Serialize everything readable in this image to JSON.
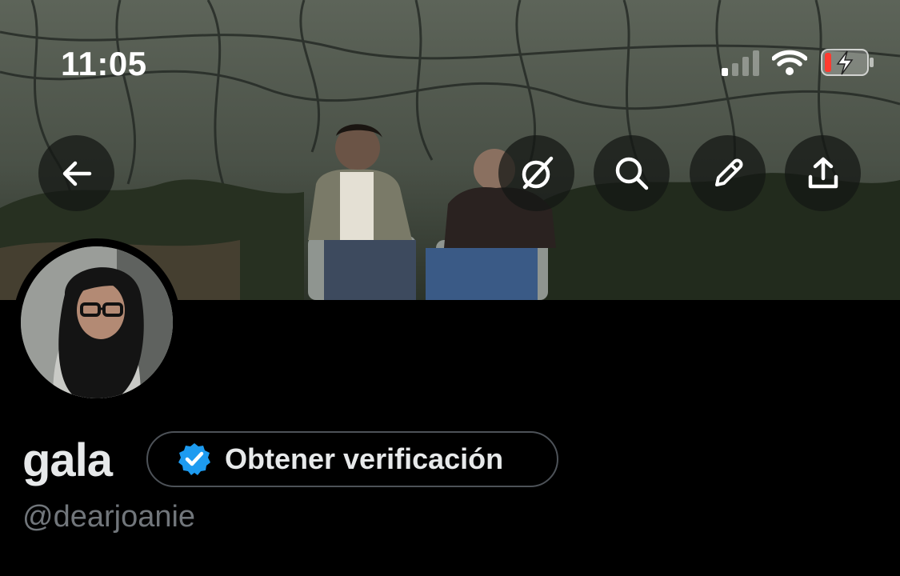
{
  "status_bar": {
    "time": "11:05",
    "signal_bars_active": 1,
    "signal_bars_total": 4,
    "battery_level": 0.15,
    "battery_charging": true
  },
  "header": {
    "buttons": [
      {
        "name": "back-button",
        "icon": "arrow-left-icon"
      },
      {
        "name": "grok-button",
        "icon": "grok-icon"
      },
      {
        "name": "search-button",
        "icon": "search-icon"
      },
      {
        "name": "edit-button",
        "icon": "pencil-icon"
      },
      {
        "name": "share-button",
        "icon": "share-icon"
      }
    ]
  },
  "profile": {
    "display_name": "gala",
    "handle": "@dearjoanie",
    "verify_button_label": "Obtener verificación"
  },
  "colors": {
    "background": "#000000",
    "verified_badge": "#1d9bf0",
    "handle_text": "#71767b",
    "battery_low": "#ff3b30"
  }
}
